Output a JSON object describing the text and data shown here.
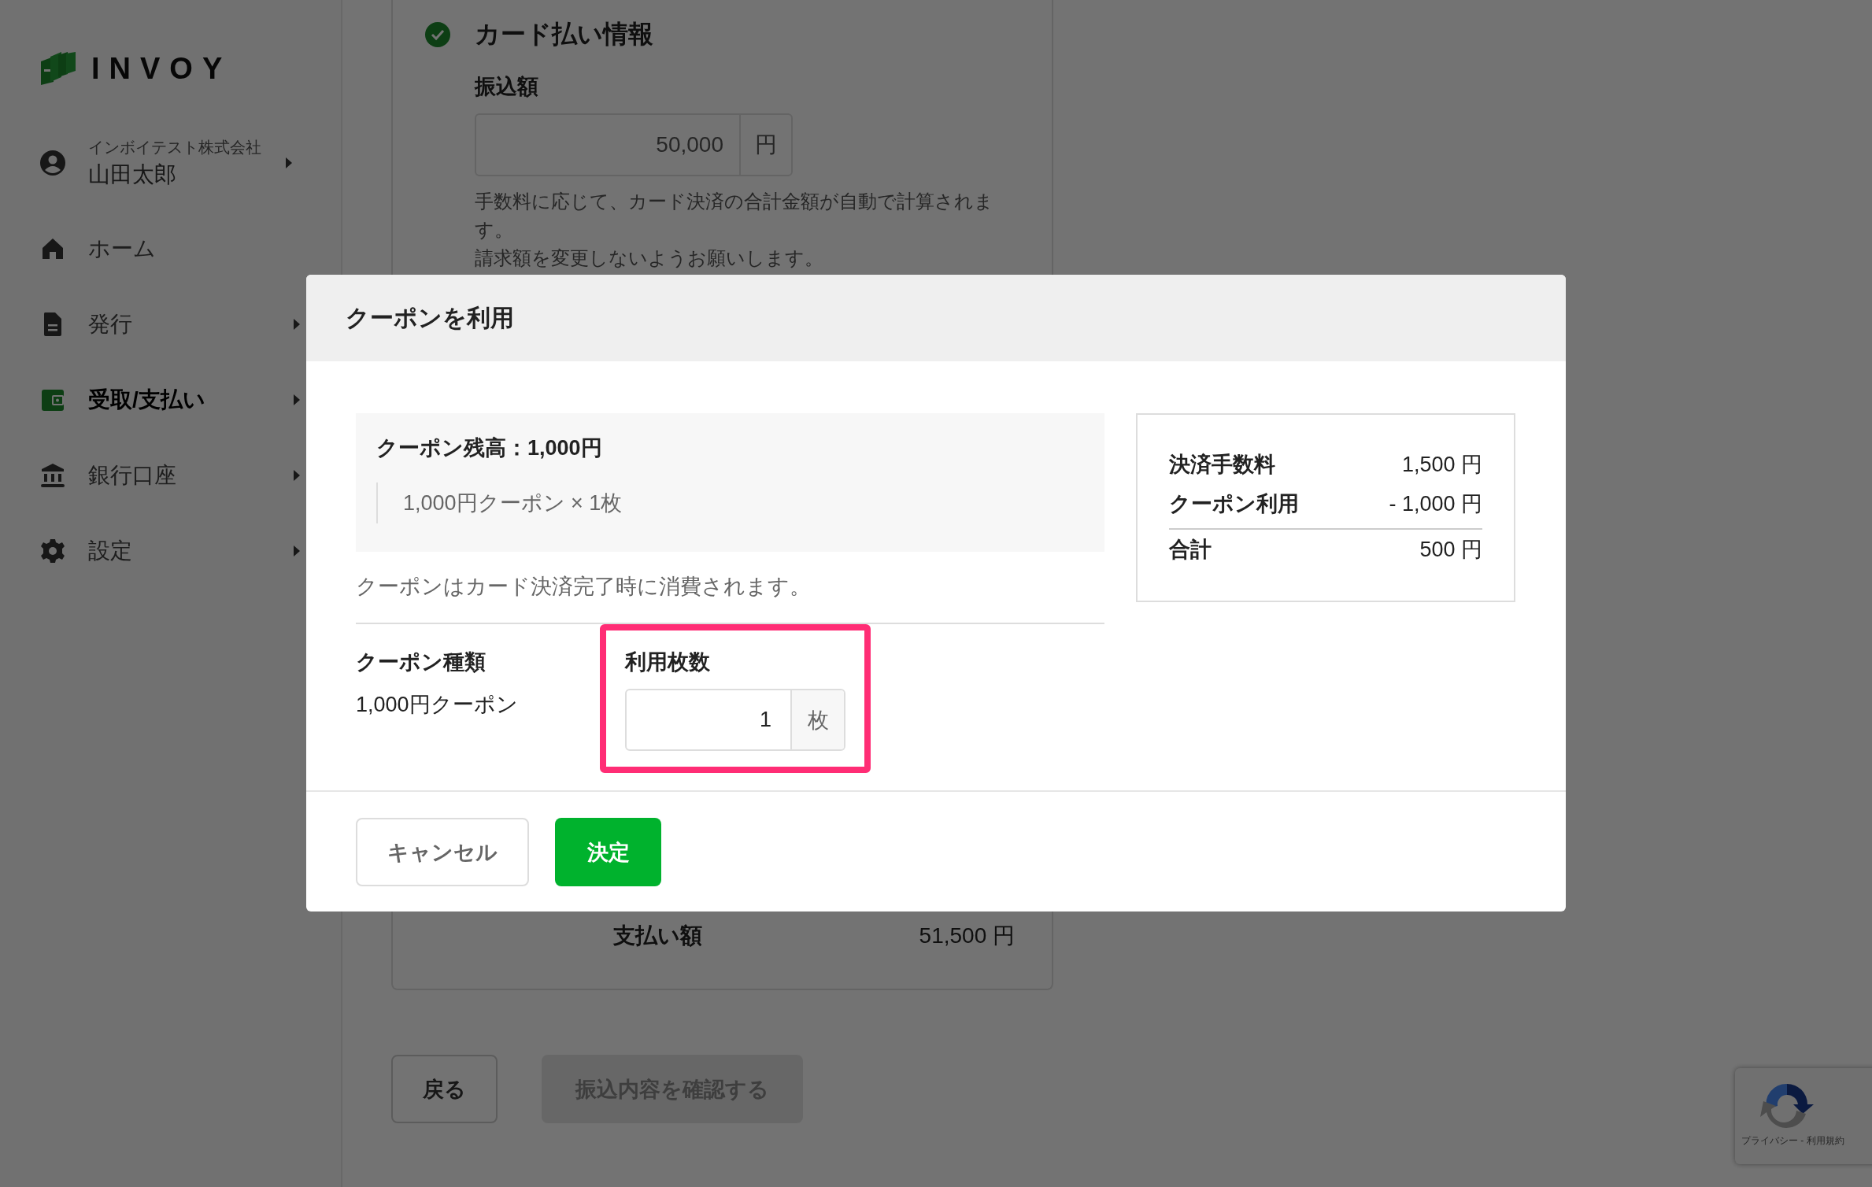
{
  "sidebar": {
    "logo": "INVOY",
    "account": {
      "company": "インボイテスト株式会社",
      "name": "山田太郎",
      "expandable": true
    },
    "items": [
      {
        "label": "ホーム",
        "selected": false,
        "expandable": false
      },
      {
        "label": "発行",
        "selected": false,
        "expandable": true
      },
      {
        "label": "受取/支払い",
        "selected": true,
        "expandable": true
      },
      {
        "label": "銀行口座",
        "selected": false,
        "expandable": true
      },
      {
        "label": "設定",
        "selected": false,
        "expandable": true
      }
    ]
  },
  "card": {
    "title": "カード払い情報",
    "completed": true,
    "amount_label": "振込額",
    "amount_value": "50,000",
    "amount_unit": "円",
    "notes": [
      "手数料に応じて、カード決済の合計金額が自動で計算されます。",
      "請求額を変更しないようお願いします。"
    ],
    "payment_label": "支払い額",
    "payment_value": "51,500 円"
  },
  "page_buttons": {
    "back": "戻る",
    "submit": "振込内容を確認する",
    "submit_disabled": true
  },
  "modal": {
    "title": "クーポンを利用",
    "balance": "クーポン残高：1,000円",
    "balance_item": "1,000円クーポン × 1枚",
    "note": "クーポンはカード決済完了時に消費されます。",
    "type_label": "クーポン種類",
    "type_value": "1,000円クーポン",
    "count_label": "利用枚数",
    "count_value": "1",
    "count_unit": "枚",
    "highlighted": true,
    "summary": [
      {
        "label": "決済手数料",
        "value": "1,500 円"
      },
      {
        "label": "クーポン利用",
        "value": "- 1,000 円"
      }
    ],
    "total": {
      "label": "合計",
      "value": "500 円"
    },
    "cancel": "キャンセル",
    "confirm": "決定"
  },
  "recaptcha": {
    "links": "プライバシー - 利用規約"
  }
}
